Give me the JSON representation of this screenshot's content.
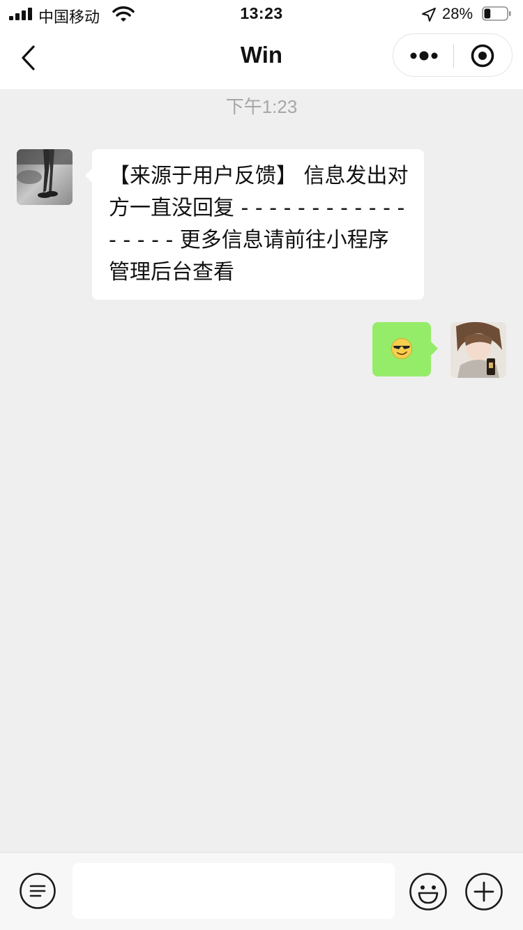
{
  "status_bar": {
    "carrier": "中国移动",
    "time": "13:23",
    "battery_percent": "28%",
    "battery_level": 0.28,
    "signal_icon": "signal-icon",
    "wifi_icon": "wifi-icon",
    "location_icon": "location-arrow-icon"
  },
  "nav": {
    "title": "Win",
    "back_icon": "back-chevron-icon",
    "more_icon": "more-dots-icon",
    "close_icon": "target-close-icon"
  },
  "chat": {
    "timestamp": "下午1:23",
    "messages": [
      {
        "side": "left",
        "text": "【来源于用户反馈】 信息发出对方一直没回复 - - - - - - - - - - - - - - - - - 更多信息请前往小程序管理后台查看"
      },
      {
        "side": "right",
        "emoji": "cool-sunglasses-emoji"
      }
    ]
  },
  "input_bar": {
    "placeholder": "",
    "voice_icon": "voice-toggle-icon",
    "emoji_icon": "emoji-smile-icon",
    "plus_icon": "plus-circle-icon"
  },
  "colors": {
    "chat_background": "#efefef",
    "my_bubble": "#95ec69",
    "their_bubble": "#ffffff"
  }
}
